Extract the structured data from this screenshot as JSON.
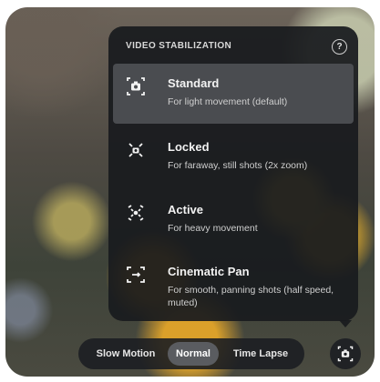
{
  "menu": {
    "title": "VIDEO STABILIZATION",
    "help_icon": "help-circle-icon",
    "help_glyph": "?",
    "options": [
      {
        "name": "Standard",
        "description": "For light movement (default)",
        "icon": "standard-stabilization-icon",
        "selected": true
      },
      {
        "name": "Locked",
        "description": "For faraway, still shots (2x zoom)",
        "icon": "locked-stabilization-icon",
        "selected": false
      },
      {
        "name": "Active",
        "description": "For heavy movement",
        "icon": "active-stabilization-icon",
        "selected": false
      },
      {
        "name": "Cinematic Pan",
        "description": "For smooth, panning shots (half speed, muted)",
        "icon": "cinematic-pan-icon",
        "selected": false
      }
    ]
  },
  "modes": {
    "items": [
      "Slow Motion",
      "Normal",
      "Time Lapse"
    ],
    "selected": "Normal"
  },
  "stabilization_button": {
    "icon": "standard-stabilization-icon"
  },
  "colors": {
    "menu_background": "#191b1e",
    "selected_background": "#4a4c50",
    "text_primary": "#f2f2f2",
    "text_secondary": "#cfcfcf"
  }
}
